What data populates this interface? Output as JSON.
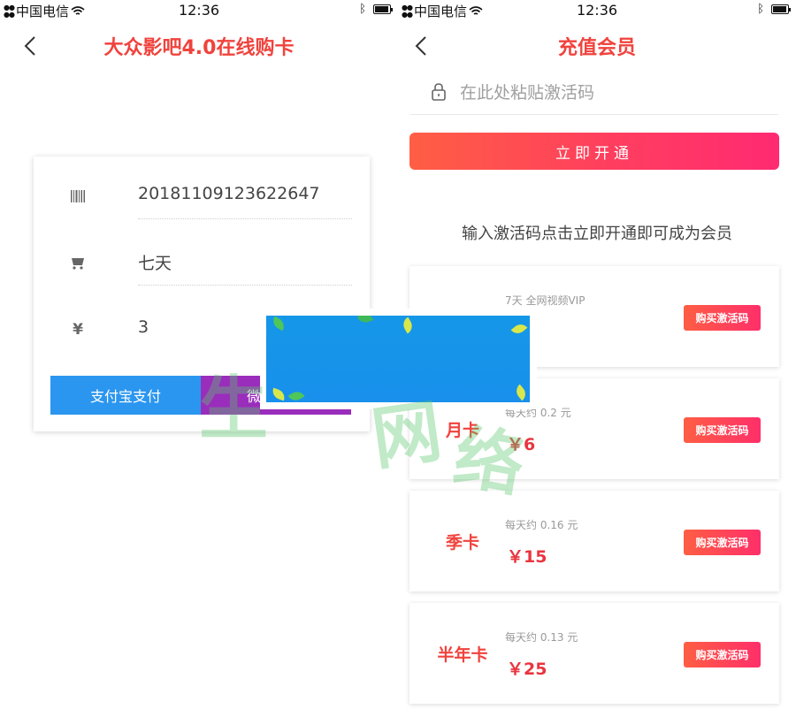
{
  "status_bar": {
    "carrier": "中国电信",
    "time": "12:36"
  },
  "left_screen": {
    "title": "大众影吧4.0在线购卡",
    "fields": [
      {
        "icon": "barcode-icon",
        "value": "20181109123622647"
      },
      {
        "icon": "cart-icon",
        "value": "七天"
      },
      {
        "icon": "yen-icon",
        "value": "3"
      }
    ],
    "pay_alipay_label": "支付宝支付",
    "pay_wechat_label_partial": "微"
  },
  "right_screen": {
    "title": "充值会员",
    "code_placeholder": "在此处粘贴激活码",
    "activate_label": "立即开通",
    "hint": "输入激活码点击立即开通即可成为会员",
    "packages": [
      {
        "name": "",
        "daily": "7天 全网视频VIP",
        "price": "",
        "buy_label": "购买激活码"
      },
      {
        "name": "月卡",
        "daily": "每天约 0.2 元",
        "price": "￥6",
        "buy_label": "购买激活码"
      },
      {
        "name": "季卡",
        "daily": "每天约 0.16 元",
        "price": "￥15",
        "buy_label": "购买激活码"
      },
      {
        "name": "半年卡",
        "daily": "每天约 0.13 元",
        "price": "￥25",
        "buy_label": "购买激活码"
      }
    ]
  },
  "watermark": [
    "生",
    "网",
    "络"
  ],
  "colors": {
    "title_red": "#f0433d",
    "alipay_blue": "#2b96ef",
    "wechat_purple": "#9a2dbb",
    "gradient_start": "#ff5e44",
    "gradient_end": "#ff2a72"
  }
}
